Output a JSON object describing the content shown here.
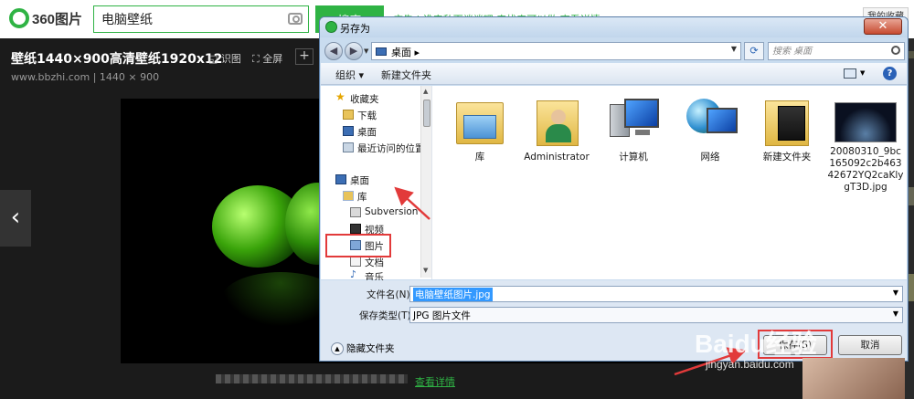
{
  "bg_page": {
    "logo_text": "360图片",
    "search_value": "电脑壁纸",
    "search_button": "搜索",
    "ad_text": "广告 | 谁来私下谈谈吧 来找来可以做 查看详情",
    "top_right_button": "我的收藏",
    "image_title": "壁纸1440×900高清壁纸1920x12",
    "tools": {
      "identify": "识图",
      "fullscreen": "全屏",
      "plus": "+"
    },
    "image_meta": "www.bbzhi.com | 1440 × 900",
    "prev_arrow": "‹",
    "view_detail": "查看详情"
  },
  "dialog": {
    "title": "另存为",
    "close": "✕",
    "address": "桌面",
    "address_arrow": "▸",
    "search_placeholder": "搜索 桌面",
    "toolbar": {
      "organize": "组织 ▾",
      "new_folder": "新建文件夹"
    },
    "nav_items": [
      {
        "label": "收藏夹",
        "icon": "star-icon"
      },
      {
        "label": "下载",
        "icon": "download-folder-icon"
      },
      {
        "label": "桌面",
        "icon": "desktop-icon"
      },
      {
        "label": "最近访问的位置",
        "icon": "recent-places-icon"
      },
      {
        "label": "桌面",
        "icon": "desktop-icon"
      },
      {
        "label": "库",
        "icon": "library-icon"
      },
      {
        "label": "Subversion",
        "icon": "subversion-icon"
      },
      {
        "label": "视频",
        "icon": "video-icon"
      },
      {
        "label": "图片",
        "icon": "pictures-icon"
      },
      {
        "label": "文档",
        "icon": "documents-icon"
      },
      {
        "label": "音乐",
        "icon": "music-icon"
      }
    ],
    "files": [
      {
        "label": "库",
        "icon": "library-folder-icon"
      },
      {
        "label": "Administrator",
        "icon": "user-folder-icon"
      },
      {
        "label": "计算机",
        "icon": "computer-icon"
      },
      {
        "label": "网络",
        "icon": "network-icon"
      },
      {
        "label": "新建文件夹",
        "icon": "folder-icon"
      },
      {
        "label": "20080310_9bc165092c2b46342672YQ2caKlygT3D.jpg",
        "icon": "image-file-icon"
      }
    ],
    "filename_label": "文件名(N):",
    "filename_value": "电脑壁纸图片.jpg",
    "filetype_label": "保存类型(T):",
    "filetype_value": "JPG 图片文件",
    "hide_folders": "隐藏文件夹",
    "save_button": "保存(S)",
    "cancel_button": "取消"
  },
  "watermark": {
    "brand": "Baidu经验",
    "url": "jingyan.baidu.com"
  },
  "colors": {
    "accent": "#2fb344",
    "highlight_red": "#e23a3a",
    "dialog_frame": "#c9dcef"
  }
}
